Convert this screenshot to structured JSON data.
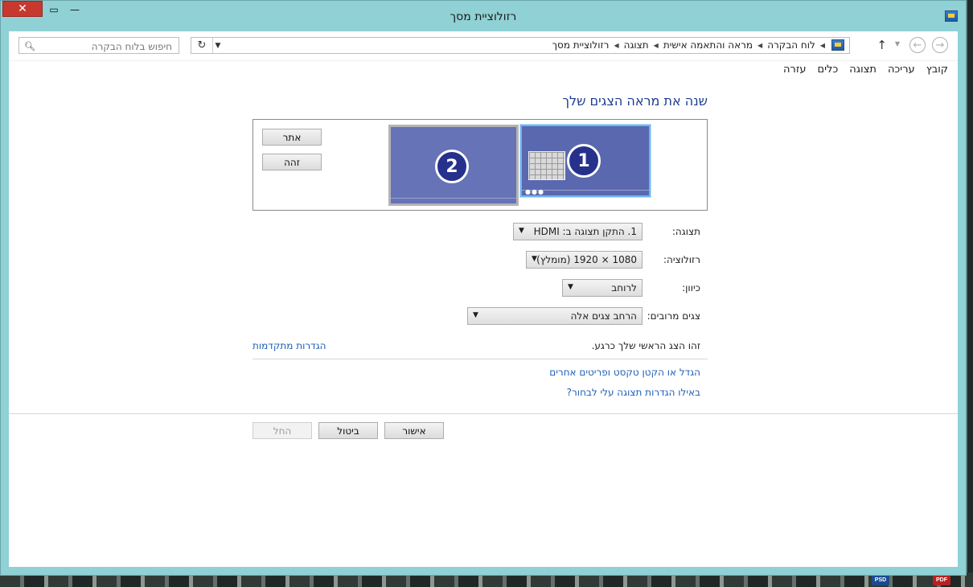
{
  "window": {
    "title": "רזולוציית מסך"
  },
  "titlebar": {
    "close_label": "✕",
    "maximize_glyph": "▭",
    "minimize_glyph": "—"
  },
  "address": {
    "breadcrumbs": [
      "לוח הבקרה",
      "מראה והתאמה אישית",
      "תצוגה",
      "רזולוציית מסך"
    ],
    "search_placeholder": "חיפוש בלוח הבקרה"
  },
  "menu": [
    "קובץ",
    "עריכה",
    "תצוגה",
    "כלים",
    "עזרה"
  ],
  "main": {
    "heading": "שנה את מראה הצגים שלך",
    "monitors": [
      {
        "number": "2"
      },
      {
        "number": "1"
      }
    ],
    "detect_label": "אתר",
    "identify_label": "זהה",
    "display_label": "תצוגה:",
    "display_value": "1. התקן תצוגה ב: HDMI",
    "resolution_label": "רזולוציה:",
    "resolution_value": "1080 × 1920 (מומלץ)",
    "orientation_label": "כיוון:",
    "orientation_value": "לרוחב",
    "multiple_label": "צגים מרובים:",
    "multiple_value": "הרחב צגים אלה",
    "primary_text": "זהו הצג הראשי שלך כרגע.",
    "advanced_link": "הגדרות מתקדמות",
    "text_size_link": "הגדל או הקטן טקסט ופריטים אחרים",
    "which_settings_link": "באילו הגדרות תצוגה עלי לבחור?"
  },
  "buttons": {
    "ok": "אישור",
    "cancel": "ביטול",
    "apply": "החל"
  },
  "taskbar_icons": {
    "psd": "PSD",
    "pdf": "PDF"
  },
  "colors": {
    "accent": "#8fd1d4",
    "link": "#1d5fb8",
    "close": "#c7392f",
    "monitor": "#5a68b0"
  }
}
